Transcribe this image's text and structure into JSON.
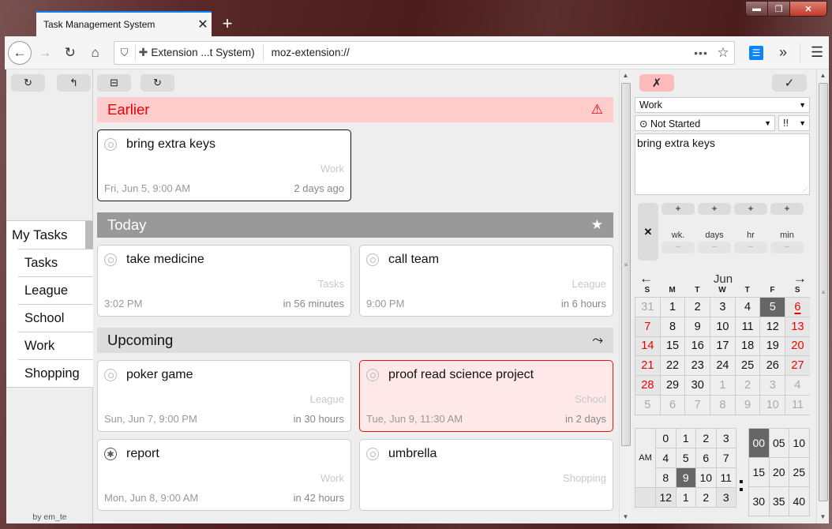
{
  "window": {
    "controls": {
      "minimize": "▬",
      "maximize": "❐",
      "close": "✕"
    }
  },
  "browser": {
    "tab_title": "Task Management System",
    "tab_close": "✕",
    "new_tab": "+",
    "nav": {
      "back": "←",
      "forward": "→",
      "reload": "↻",
      "home": "⌂"
    },
    "url_identity": "Extension ...t System)",
    "url": "moz-extension://",
    "page_actions": "•••",
    "bookmark_star": "☆",
    "overflow": "»",
    "menu": "☰",
    "extension_icon": "☰"
  },
  "sidebar": {
    "toolbar": [
      {
        "icon": "↻",
        "name": "refresh"
      },
      {
        "icon": "↰",
        "name": "undo"
      }
    ],
    "header": "My Tasks",
    "lists": [
      "Tasks",
      "League",
      "School",
      "Work",
      "Shopping"
    ],
    "byline": "by em_te"
  },
  "main": {
    "toolbar": [
      {
        "icon": "⊟",
        "name": "collapse"
      },
      {
        "icon": "↻",
        "name": "refresh"
      }
    ],
    "sections": [
      {
        "title": "Earlier",
        "icon": "⚠",
        "style": "earlier",
        "tasks": [
          {
            "title": "bring extra keys",
            "list": "Work",
            "date": "Fri, Jun 5, 9:00 AM",
            "relative": "2 days ago",
            "status": "not-started",
            "selected": true
          }
        ]
      },
      {
        "title": "Today",
        "icon": "★",
        "style": "today",
        "tasks": [
          {
            "title": "take medicine",
            "list": "Tasks",
            "date": "3:02 PM",
            "relative": "in 56 minutes",
            "status": "not-started"
          },
          {
            "title": "call team",
            "list": "League",
            "date": "9:00 PM",
            "relative": "in 6 hours",
            "status": "not-started"
          }
        ]
      },
      {
        "title": "Upcoming",
        "icon": "⤳",
        "style": "upcoming",
        "tasks": [
          {
            "title": "poker game",
            "list": "League",
            "date": "Sun, Jun 7, 9:00 PM",
            "relative": "in 30 hours",
            "status": "not-started"
          },
          {
            "title": "proof read science project",
            "list": "School",
            "date": "Tue, Jun 9, 11:30 AM",
            "relative": "in 2 days",
            "status": "not-started",
            "overdue_style": true
          },
          {
            "title": "report",
            "list": "Work",
            "date": "Mon, Jun 8, 9:00 AM",
            "relative": "in 42 hours",
            "status": "starred"
          },
          {
            "title": "umbrella",
            "list": "Shopping",
            "date": "",
            "relative": "",
            "status": "not-started"
          }
        ]
      }
    ]
  },
  "editor": {
    "cancel": "✗",
    "save": "✓",
    "list_select": "Work",
    "status_select": "⊙ Not Started",
    "priority_select": "!!",
    "task_text": "bring extra keys",
    "duration": {
      "clear": "✕",
      "plus": "+",
      "minus": "–",
      "units": [
        "wk.",
        "days",
        "hr",
        "min"
      ]
    },
    "calendar": {
      "prev": "←",
      "next": "→",
      "month": "Jun",
      "weekdays": [
        "S",
        "M",
        "T",
        "W",
        "T",
        "F",
        "S"
      ],
      "days": [
        [
          31,
          1,
          2,
          3,
          4,
          5,
          6
        ],
        [
          7,
          8,
          9,
          10,
          11,
          12,
          13
        ],
        [
          14,
          15,
          16,
          17,
          18,
          19,
          20
        ],
        [
          21,
          22,
          23,
          24,
          25,
          26,
          27
        ],
        [
          28,
          29,
          30,
          1,
          2,
          3,
          4
        ],
        [
          5,
          6,
          7,
          8,
          9,
          10,
          11
        ]
      ],
      "selected_day": 5,
      "today_day": 6
    },
    "time": {
      "ampm": "AM",
      "hours_am": [
        "0",
        "1",
        "2",
        "3",
        "4",
        "5",
        "6",
        "7",
        "8",
        "9",
        "10",
        "11"
      ],
      "hours_pm": [
        "12",
        "1",
        "2",
        "3"
      ],
      "selected_hour": "9",
      "minutes": [
        "00",
        "05",
        "10",
        "15",
        "20",
        "25",
        "30",
        "35",
        "40"
      ],
      "selected_minute": "00",
      "separator": ":"
    }
  }
}
